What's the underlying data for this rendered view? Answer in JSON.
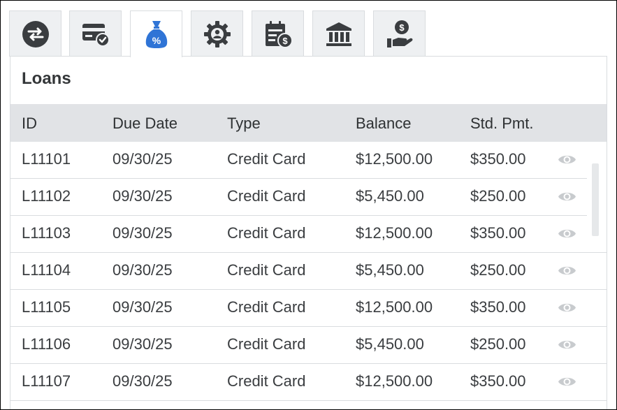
{
  "tabs": [
    {
      "icon": "transfer-icon",
      "active": false
    },
    {
      "icon": "card-check-icon",
      "active": false
    },
    {
      "icon": "money-bag-percent-icon",
      "active": true
    },
    {
      "icon": "gear-user-icon",
      "active": false
    },
    {
      "icon": "bill-dollar-icon",
      "active": false
    },
    {
      "icon": "bank-icon",
      "active": false
    },
    {
      "icon": "hand-dollar-icon",
      "active": false
    }
  ],
  "colors": {
    "active_icon": "#2f74d6",
    "icon": "#3a3d40",
    "header_bg": "#e1e3e6",
    "eye": "#c8cbce"
  },
  "panel": {
    "title": "Loans"
  },
  "table": {
    "columns": [
      "ID",
      "Due Date",
      "Type",
      "Balance",
      "Std. Pmt."
    ],
    "rows": [
      {
        "id": "L11101",
        "due": "09/30/25",
        "type": "Credit Card",
        "balance": "$12,500.00",
        "pmt": "$350.00"
      },
      {
        "id": "L11102",
        "due": "09/30/25",
        "type": "Credit Card",
        "balance": "$5,450.00",
        "pmt": "$250.00"
      },
      {
        "id": "L11103",
        "due": "09/30/25",
        "type": "Credit Card",
        "balance": "$12,500.00",
        "pmt": "$350.00"
      },
      {
        "id": "L11104",
        "due": "09/30/25",
        "type": "Credit Card",
        "balance": "$5,450.00",
        "pmt": "$250.00"
      },
      {
        "id": "L11105",
        "due": "09/30/25",
        "type": "Credit Card",
        "balance": "$12,500.00",
        "pmt": "$350.00"
      },
      {
        "id": "L11106",
        "due": "09/30/25",
        "type": "Credit Card",
        "balance": "$5,450.00",
        "pmt": "$250.00"
      },
      {
        "id": "L11107",
        "due": "09/30/25",
        "type": "Credit Card",
        "balance": "$12,500.00",
        "pmt": "$350.00"
      }
    ]
  }
}
